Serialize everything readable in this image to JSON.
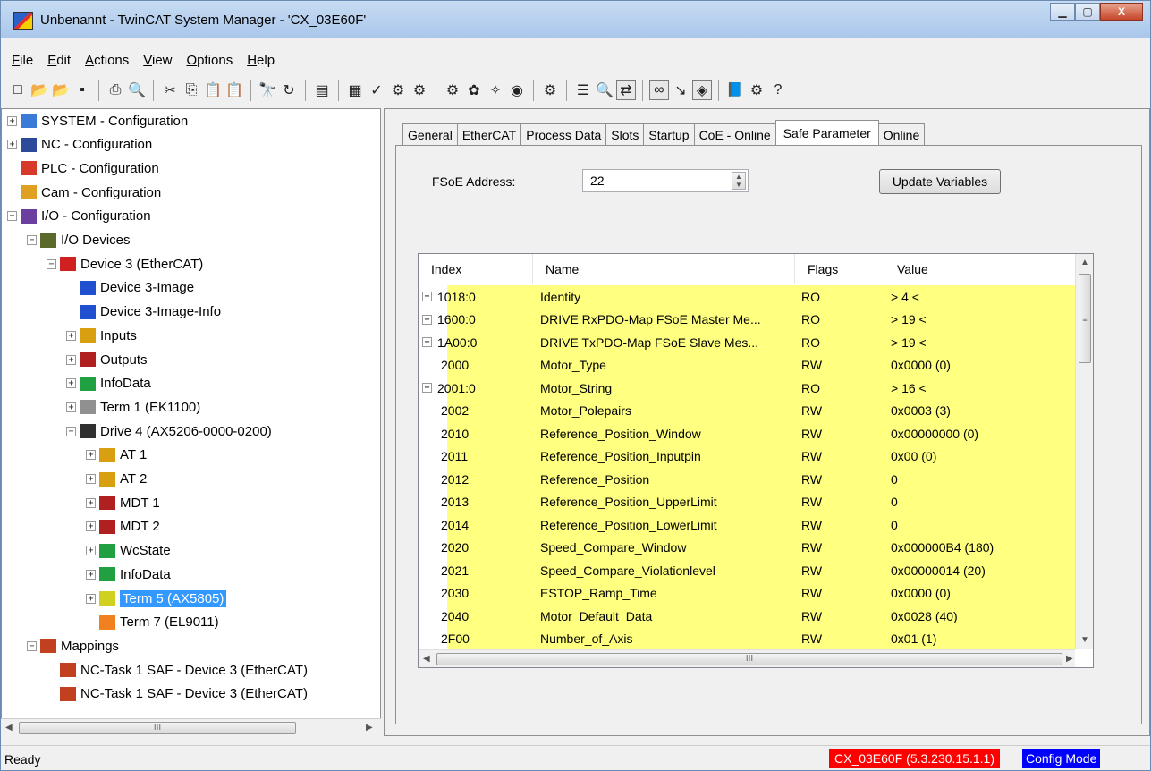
{
  "window": {
    "title": "Unbenannt - TwinCAT System Manager - 'CX_03E60F'",
    "minimize": "▁",
    "maximize": "▢",
    "close": "X"
  },
  "menu": [
    "File",
    "Edit",
    "Actions",
    "View",
    "Options",
    "Help"
  ],
  "tree": [
    {
      "label": "SYSTEM - Configuration",
      "indent": 0,
      "exp": "+",
      "icon": "#3b7bd8"
    },
    {
      "label": "NC - Configuration",
      "indent": 0,
      "exp": "+",
      "icon": "#2c4a9a"
    },
    {
      "label": "PLC - Configuration",
      "indent": 0,
      "exp": "",
      "icon": "#d83a2a"
    },
    {
      "label": "Cam - Configuration",
      "indent": 0,
      "exp": "",
      "icon": "#e0a020"
    },
    {
      "label": "I/O - Configuration",
      "indent": 0,
      "exp": "-",
      "icon": "#6b3fa0"
    },
    {
      "label": "I/O Devices",
      "indent": 1,
      "exp": "-",
      "icon": "#5a6a2a"
    },
    {
      "label": "Device 3 (EtherCAT)",
      "indent": 2,
      "exp": "-",
      "icon": "#d02020"
    },
    {
      "label": "Device 3-Image",
      "indent": 3,
      "exp": "",
      "icon": "#2050d0"
    },
    {
      "label": "Device 3-Image-Info",
      "indent": 3,
      "exp": "",
      "icon": "#2050d0"
    },
    {
      "label": "Inputs",
      "indent": 3,
      "exp": "+",
      "icon": "#d8a010"
    },
    {
      "label": "Outputs",
      "indent": 3,
      "exp": "+",
      "icon": "#b02020"
    },
    {
      "label": "InfoData",
      "indent": 3,
      "exp": "+",
      "icon": "#20a040"
    },
    {
      "label": "Term 1 (EK1100)",
      "indent": 3,
      "exp": "+",
      "icon": "#909090"
    },
    {
      "label": "Drive 4 (AX5206-0000-0200)",
      "indent": 3,
      "exp": "-",
      "icon": "#303030"
    },
    {
      "label": "AT 1",
      "indent": 4,
      "exp": "+",
      "icon": "#d8a010"
    },
    {
      "label": "AT 2",
      "indent": 4,
      "exp": "+",
      "icon": "#d8a010"
    },
    {
      "label": "MDT 1",
      "indent": 4,
      "exp": "+",
      "icon": "#b02020"
    },
    {
      "label": "MDT 2",
      "indent": 4,
      "exp": "+",
      "icon": "#b02020"
    },
    {
      "label": "WcState",
      "indent": 4,
      "exp": "+",
      "icon": "#20a040"
    },
    {
      "label": "InfoData",
      "indent": 4,
      "exp": "+",
      "icon": "#20a040"
    },
    {
      "label": "Term 5 (AX5805)",
      "indent": 4,
      "exp": "+",
      "icon": "#d0d020",
      "selected": true
    },
    {
      "label": "Term 7 (EL9011)",
      "indent": 4,
      "exp": "",
      "icon": "#f08020"
    },
    {
      "label": "Mappings",
      "indent": 1,
      "exp": "-",
      "icon": "#c04020"
    },
    {
      "label": "NC-Task 1 SAF - Device 3 (EtherCAT)",
      "indent": 2,
      "exp": "",
      "icon": "#c04020"
    },
    {
      "label": "NC-Task 1 SAF - Device 3 (EtherCAT)",
      "indent": 2,
      "exp": "",
      "icon": "#c04020"
    }
  ],
  "tabs": [
    "General",
    "EtherCAT",
    "Process Data",
    "Slots",
    "Startup",
    "CoE - Online",
    "Safe Parameter",
    "Online"
  ],
  "active_tab": "Safe Parameter",
  "fsoe": {
    "label": "FSoE Address:",
    "value": "22"
  },
  "update_button": "Update Variables",
  "list_headers": {
    "index": "Index",
    "name": "Name",
    "flags": "Flags",
    "value": "Value"
  },
  "rows": [
    {
      "index": "1018:0",
      "name": "Identity",
      "flags": "RO",
      "value": "> 4 <",
      "exp": "+"
    },
    {
      "index": "1600:0",
      "name": "DRIVE RxPDO-Map FSoE Master Me...",
      "flags": "RO",
      "value": "> 19 <",
      "exp": "+"
    },
    {
      "index": "1A00:0",
      "name": "DRIVE TxPDO-Map FSoE Slave Mes...",
      "flags": "RO",
      "value": "> 19 <",
      "exp": "+"
    },
    {
      "index": "2000",
      "name": "Motor_Type",
      "flags": "RW",
      "value": "0x0000 (0)",
      "exp": ""
    },
    {
      "index": "2001:0",
      "name": "Motor_String",
      "flags": "RO",
      "value": "> 16 <",
      "exp": "+"
    },
    {
      "index": "2002",
      "name": "Motor_Polepairs",
      "flags": "RW",
      "value": "0x0003 (3)",
      "exp": ""
    },
    {
      "index": "2010",
      "name": "Reference_Position_Window",
      "flags": "RW",
      "value": "0x00000000 (0)",
      "exp": ""
    },
    {
      "index": "2011",
      "name": "Reference_Position_Inputpin",
      "flags": "RW",
      "value": "0x00 (0)",
      "exp": ""
    },
    {
      "index": "2012",
      "name": "Reference_Position",
      "flags": "RW",
      "value": "0",
      "exp": ""
    },
    {
      "index": "2013",
      "name": "Reference_Position_UpperLimit",
      "flags": "RW",
      "value": "0",
      "exp": ""
    },
    {
      "index": "2014",
      "name": "Reference_Position_LowerLimit",
      "flags": "RW",
      "value": "0",
      "exp": ""
    },
    {
      "index": "2020",
      "name": "Speed_Compare_Window",
      "flags": "RW",
      "value": "0x000000B4 (180)",
      "exp": ""
    },
    {
      "index": "2021",
      "name": "Speed_Compare_Violationlevel",
      "flags": "RW",
      "value": "0x00000014 (20)",
      "exp": ""
    },
    {
      "index": "2030",
      "name": "ESTOP_Ramp_Time",
      "flags": "RW",
      "value": "0x0000 (0)",
      "exp": ""
    },
    {
      "index": "2040",
      "name": "Motor_Default_Data",
      "flags": "RW",
      "value": "0x0028 (40)",
      "exp": ""
    },
    {
      "index": "2F00",
      "name": "Number_of_Axis",
      "flags": "RW",
      "value": "0x01 (1)",
      "exp": ""
    }
  ],
  "status": {
    "text": "Ready",
    "target": "CX_03E60F (5.3.230.15.1.1)",
    "mode": "Config Mode",
    "target_color": "#ff0000",
    "mode_color": "#0000ff"
  }
}
